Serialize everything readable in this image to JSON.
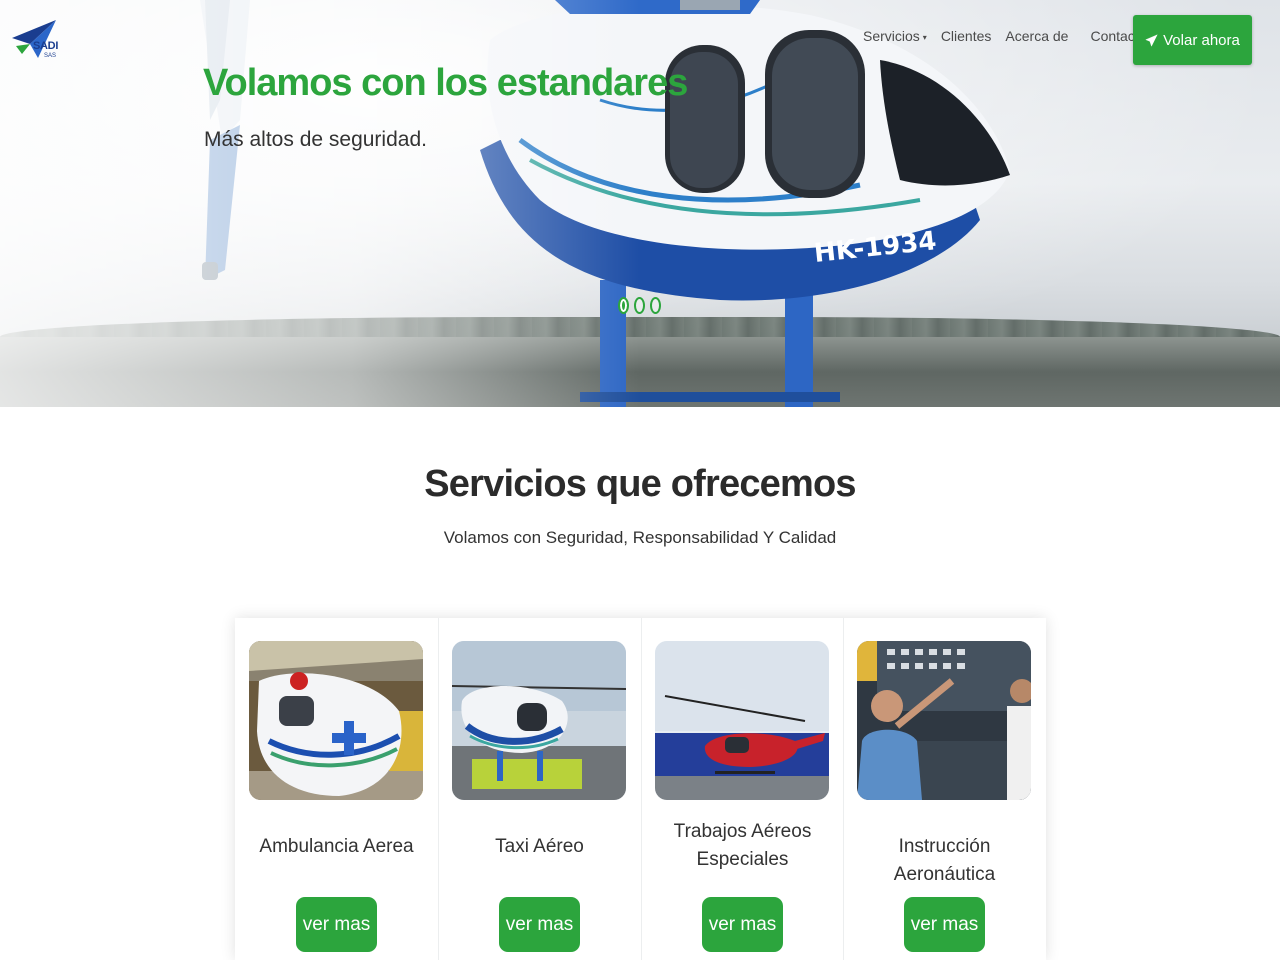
{
  "header": {
    "logo_text": "SADI",
    "logo_sub": "SAS",
    "nav": [
      {
        "label": "Servicios",
        "has_dropdown": true
      },
      {
        "label": "Clientes",
        "has_dropdown": false
      },
      {
        "label": "Acerca de",
        "has_dropdown": false
      },
      {
        "label": "Contacto",
        "has_dropdown": false
      }
    ],
    "cta_label": "Volar ahora",
    "cta_icon": "paper-plane-icon"
  },
  "hero": {
    "title": "Volamos con los estandares",
    "subtitle": "Más altos de seguridad.",
    "slide_count": 3,
    "active_slide": 1
  },
  "services": {
    "title": "Servicios que ofrecemos",
    "subtitle": "Volamos con Seguridad, Responsabilidad Y Calidad",
    "items": [
      {
        "label": "Ambulancia Aerea",
        "button": "ver mas"
      },
      {
        "label": "Taxi Aéreo",
        "button": "ver mas"
      },
      {
        "label": "Trabajos Aéreos Especiales",
        "button": "ver mas"
      },
      {
        "label": "Instrucción Aeronáutica",
        "button": "ver mas"
      }
    ]
  },
  "colors": {
    "accent": "#2ca53d",
    "brand_blue": "#1a3d8f",
    "heading": "#2b2b2b"
  }
}
